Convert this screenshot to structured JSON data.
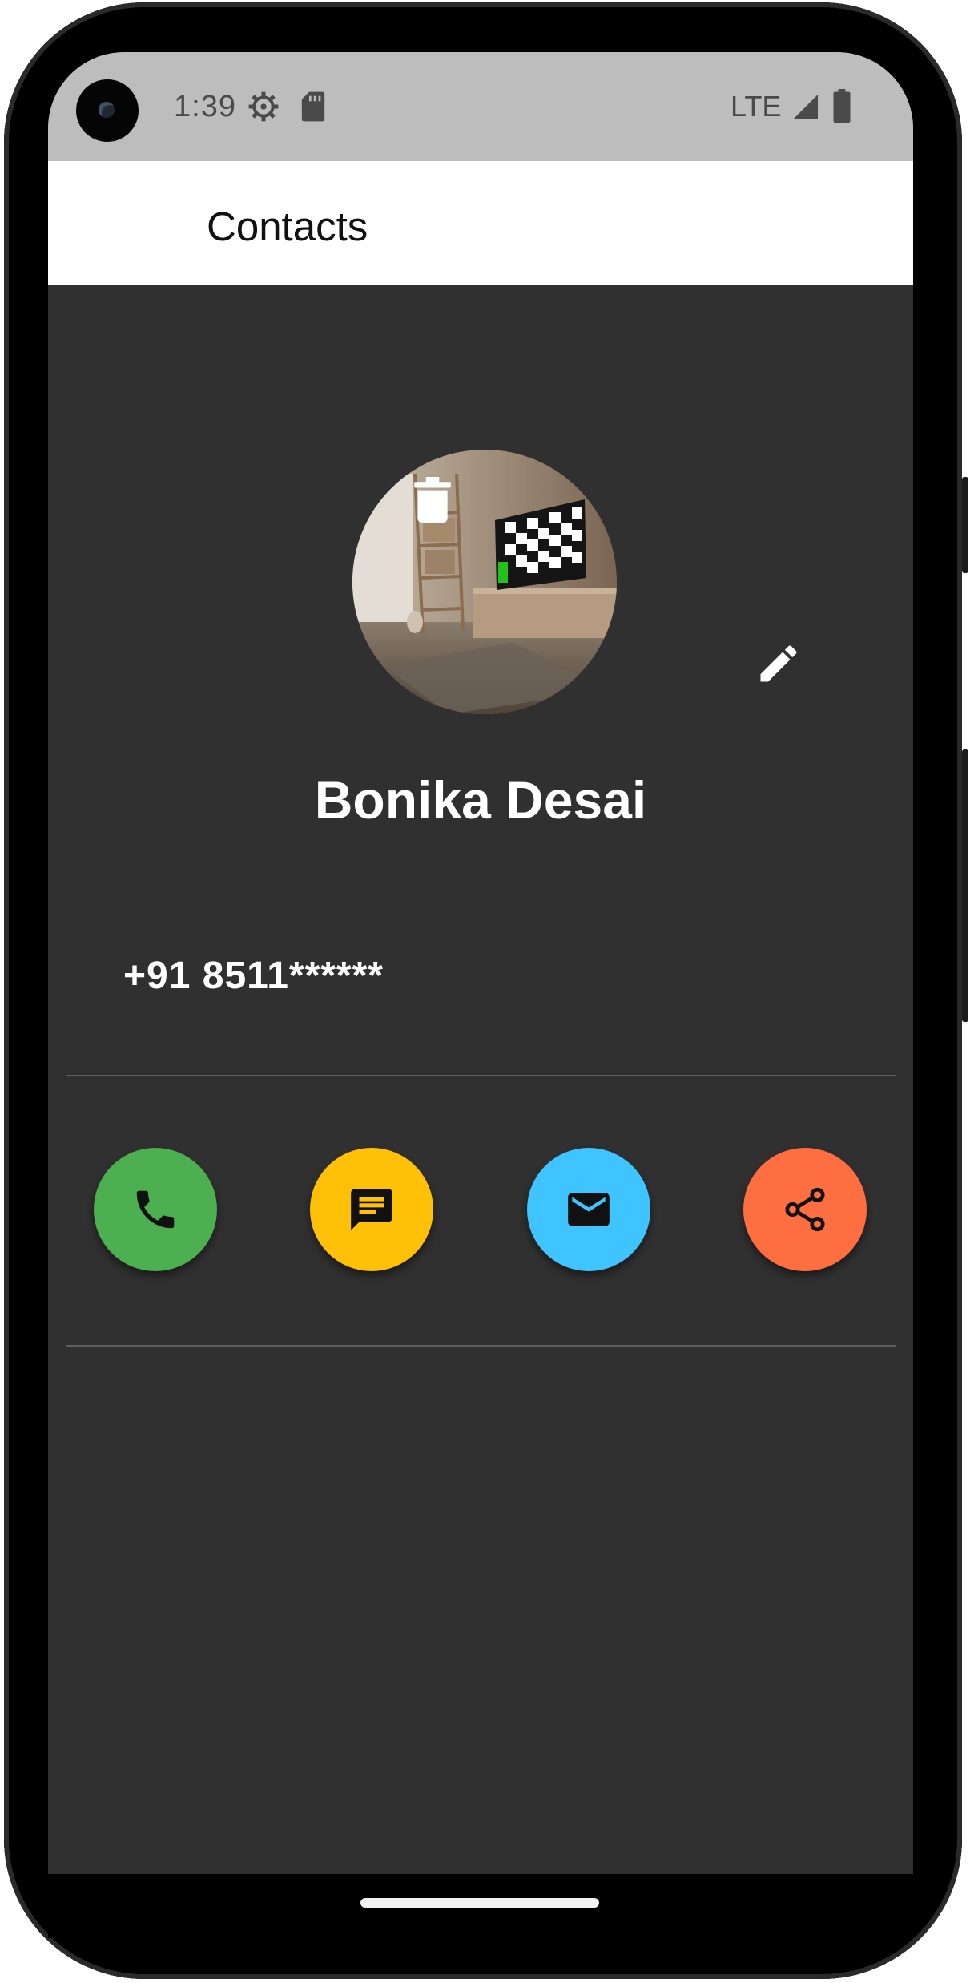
{
  "status_bar": {
    "time": "1:39",
    "network": "LTE",
    "icons": [
      "settings-gear-icon",
      "sd-card-icon",
      "cell-signal-icon",
      "battery-icon"
    ]
  },
  "app_bar": {
    "title": "Contacts"
  },
  "contact": {
    "name": "Bonika Desai",
    "phone": "+91 8511******",
    "photo": "room-with-tv-photo"
  },
  "actions": {
    "delete_icon": "trash-icon",
    "edit_icon": "pencil-icon"
  },
  "quick_actions": [
    {
      "name": "call",
      "icon": "phone-icon",
      "color": "#4caf50"
    },
    {
      "name": "message",
      "icon": "message-icon",
      "color": "#ffc107"
    },
    {
      "name": "email",
      "icon": "mail-icon",
      "color": "#40c4ff"
    },
    {
      "name": "share",
      "icon": "share-icon",
      "color": "#ff6e40"
    }
  ],
  "colors": {
    "background": "#303030",
    "app_bar": "#ffffff",
    "status_bar": "#bdbdbd"
  }
}
